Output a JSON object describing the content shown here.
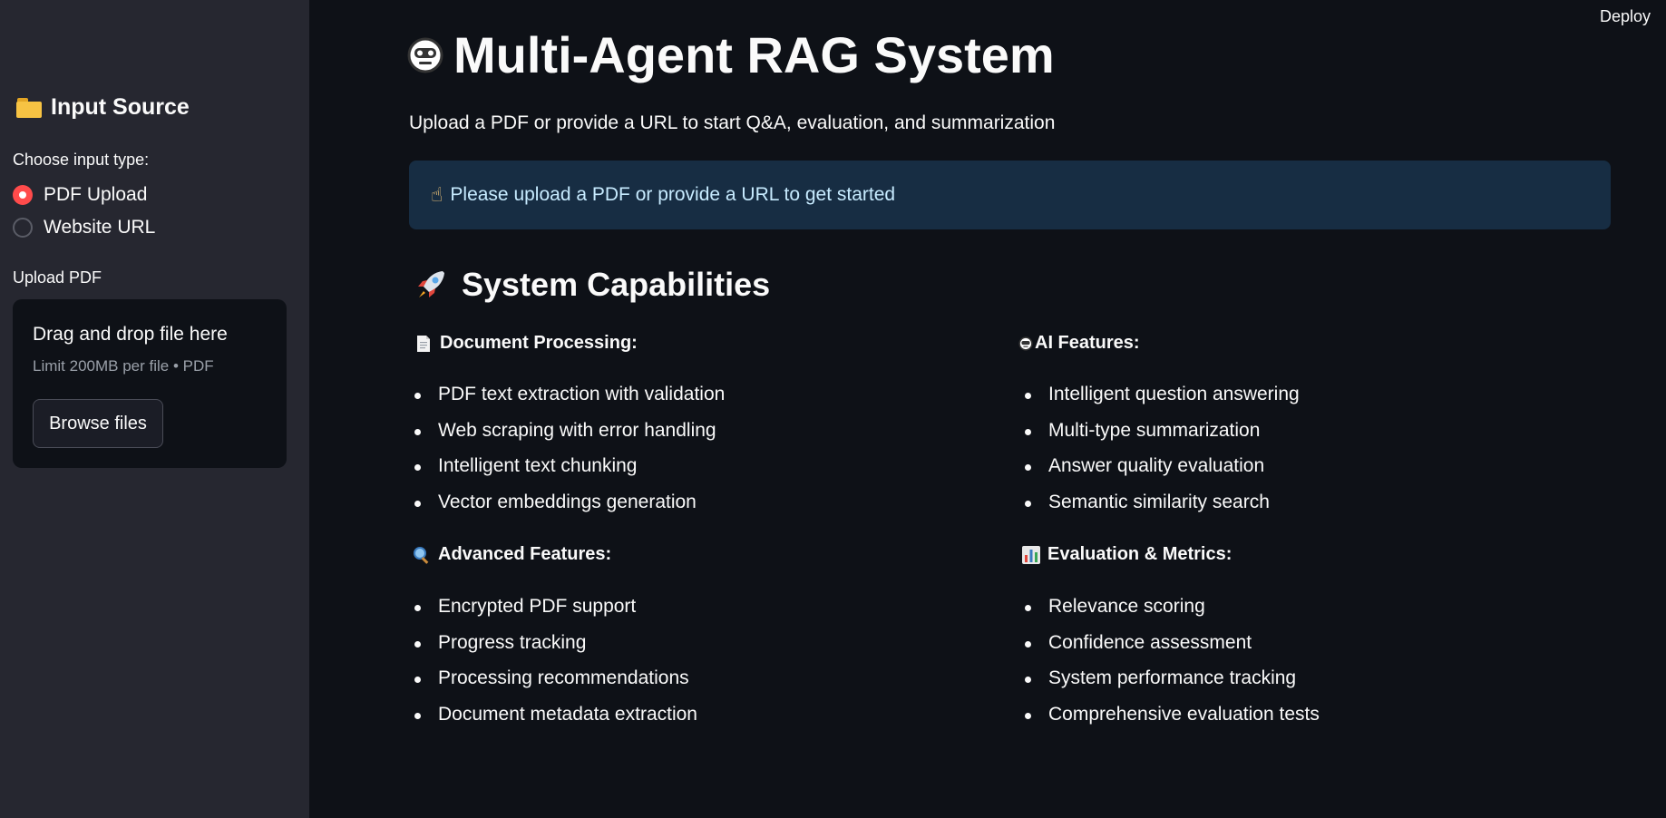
{
  "header": {
    "deploy_label": "Deploy"
  },
  "sidebar": {
    "title": "Input Source",
    "title_icon": "folder-icon",
    "radio_group_label": "Choose input type:",
    "radio_options": [
      {
        "label": "PDF Upload",
        "checked": true
      },
      {
        "label": "Website URL",
        "checked": false
      }
    ],
    "upload": {
      "label": "Upload PDF",
      "dropzone_title": "Drag and drop file here",
      "limit_text": "Limit 200MB per file • PDF",
      "browse_label": "Browse files"
    }
  },
  "main": {
    "title": "Multi-Agent RAG System",
    "title_icon": "robot-icon",
    "subtitle": "Upload a PDF or provide a URL to start Q&A, evaluation, and summarization",
    "info_message": "Please upload a PDF or provide a URL to get started",
    "info_icon": "pointing-hand-icon",
    "capabilities": {
      "title": "System Capabilities",
      "icon": "rocket-icon",
      "sections": [
        {
          "heading": "Document Processing:",
          "icon": "document-icon",
          "items": [
            "PDF text extraction with validation",
            "Web scraping with error handling",
            "Intelligent text chunking",
            "Vector embeddings generation"
          ]
        },
        {
          "heading": "AI Features:",
          "icon": "robot-icon",
          "items": [
            "Intelligent question answering",
            "Multi-type summarization",
            "Answer quality evaluation",
            "Semantic similarity search"
          ]
        },
        {
          "heading": "Advanced Features:",
          "icon": "magnifier-icon",
          "items": [
            "Encrypted PDF support",
            "Progress tracking",
            "Processing recommendations",
            "Document metadata extraction"
          ]
        },
        {
          "heading": "Evaluation & Metrics:",
          "icon": "bar-chart-icon",
          "items": [
            "Relevance scoring",
            "Confidence assessment",
            "System performance tracking",
            "Comprehensive evaluation tests"
          ]
        }
      ]
    }
  },
  "colors": {
    "background": "#0e1117",
    "sidebar": "#262730",
    "accent": "#ff4b4b",
    "info_background": "#172d43",
    "info_text": "#c7ebff"
  }
}
